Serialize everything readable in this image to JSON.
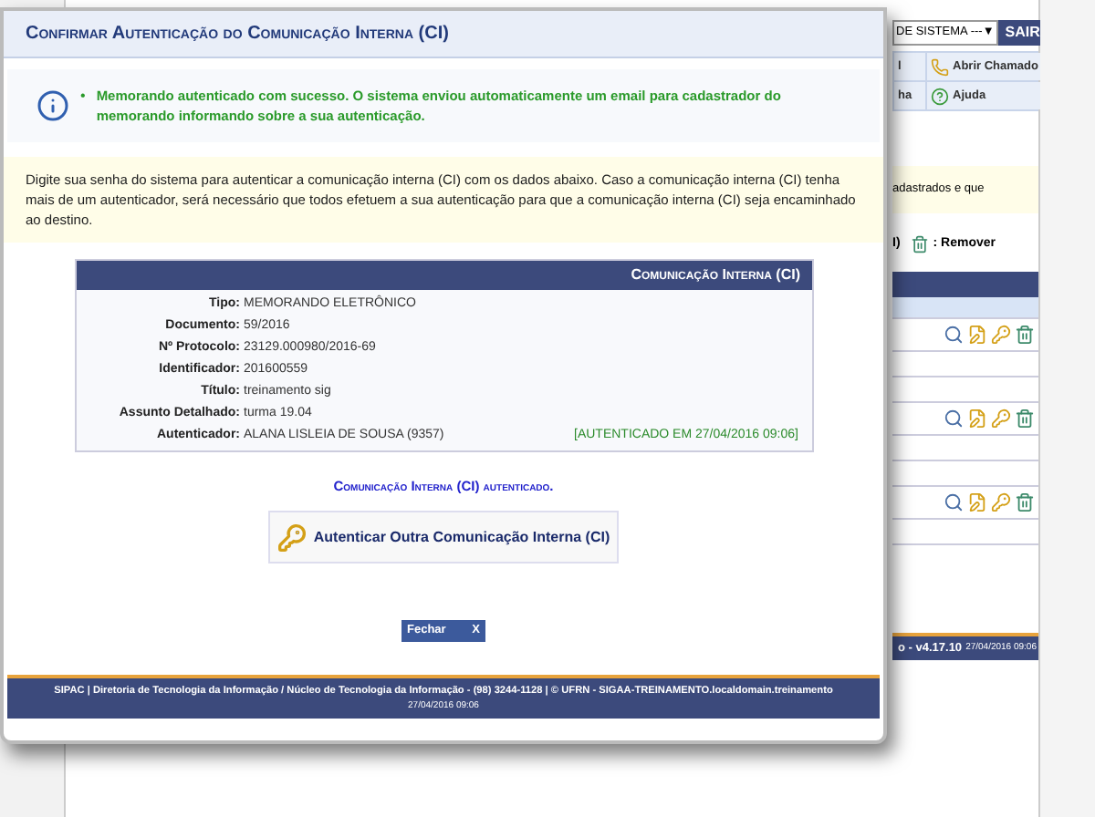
{
  "window": {
    "title": "Confirmar Autenticação do Comunicação Interna (CI)"
  },
  "message": {
    "bullet": "•",
    "text": "Memorando autenticado com sucesso. O sistema enviou automaticamente um email para cadastrador do memorando informando sobre a sua autenticação."
  },
  "instructions": "Digite sua senha do sistema para autenticar a comunicação interna (CI) com os dados abaixo. Caso a comunicação interna (CI) tenha mais de um autenticador, será necessário que todos efetuem a sua autenticação para que a comunicação interna (CI) seja encaminhado ao destino.",
  "details": {
    "title": "Comunicação Interna (CI)",
    "rows": [
      {
        "label": "Tipo:",
        "value": "MEMORANDO ELETRÔNICO"
      },
      {
        "label": "Documento:",
        "value": "59/2016"
      },
      {
        "label": "Nº Protocolo:",
        "value": "23129.000980/2016-69"
      },
      {
        "label": "Identificador:",
        "value": "201600559"
      },
      {
        "label": "Título:",
        "value": "treinamento sig"
      },
      {
        "label": "Assunto Detalhado:",
        "value": "turma 19.04"
      },
      {
        "label": "Autenticador:",
        "value": "ALANA LISLEIA DE SOUSA (9357)",
        "status": "[AUTENTICADO EM 27/04/2016 09:06]"
      }
    ]
  },
  "confirmation": "Comunicação Interna (CI) autenticado.",
  "action_button": "Autenticar Outra Comunicação Interna (CI)",
  "close_button": {
    "label": "Fechar",
    "icon": "X"
  },
  "footer": {
    "text": "SIPAC | Diretoria de Tecnologia da Informação / Núcleo de Tecnologia da Informação - (98) 3244-1128 | © UFRN - SIGAA-TREINAMENTO.localdomain.treinamento",
    "date": "27/04/2016 09:06"
  },
  "background_page": {
    "select": "DE SISTEMA ---",
    "select_arrow": "▼",
    "logout": "SAIR",
    "menu": [
      {
        "label": "l",
        "kind": "plain"
      },
      {
        "label": "Abrir Chamado",
        "kind": "ticket"
      },
      {
        "label": "ha",
        "kind": "plain"
      },
      {
        "label": "Ajuda",
        "kind": "help"
      }
    ],
    "notice": "adastrados e que",
    "legend": {
      "fragment": "I)",
      "label": ": Remover"
    },
    "version": "o - v4.17.10",
    "date": "27/04/2016 09:06"
  }
}
